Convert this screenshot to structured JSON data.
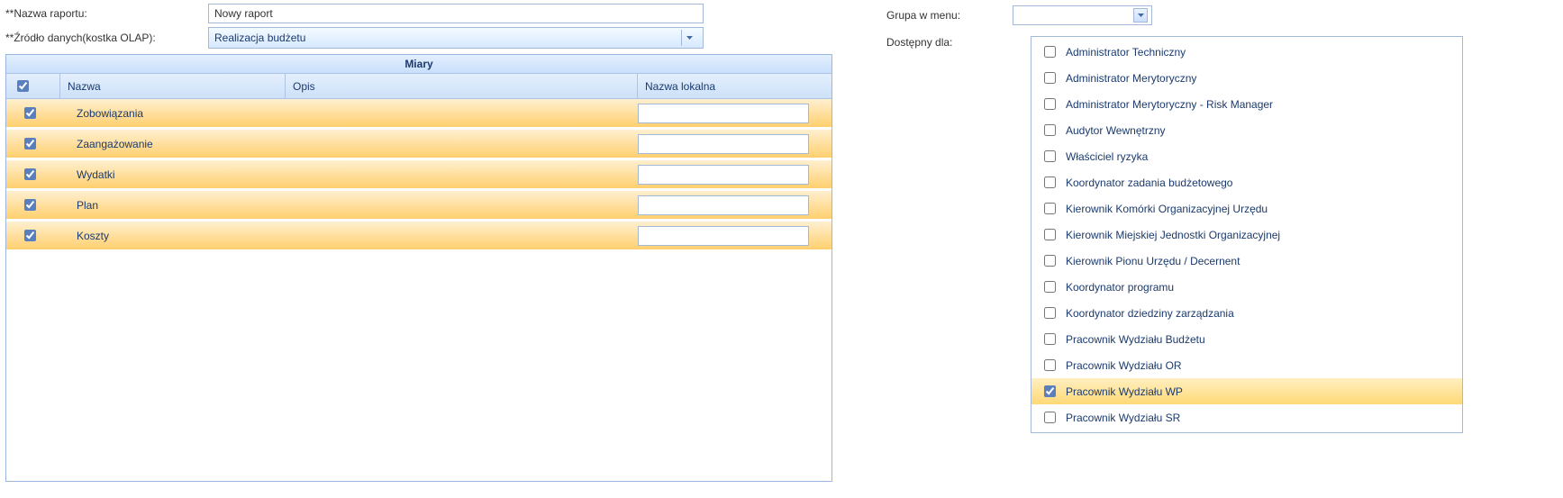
{
  "labels": {
    "report_name": "**Nazwa raportu:",
    "data_source": "**Źródło danych(kostka OLAP):",
    "group_menu": "Grupa w menu:",
    "available_for": "Dostępny dla:"
  },
  "form": {
    "report_name_value": "Nowy raport",
    "data_source_value": "Realizacja budżetu",
    "group_menu_value": ""
  },
  "measures": {
    "title": "Miary",
    "header_name": "Nazwa",
    "header_desc": "Opis",
    "header_local": "Nazwa lokalna",
    "rows": [
      {
        "checked": true,
        "name": "Zobowiązania",
        "desc": "",
        "local": ""
      },
      {
        "checked": true,
        "name": "Zaangażowanie",
        "desc": "",
        "local": ""
      },
      {
        "checked": true,
        "name": "Wydatki",
        "desc": "",
        "local": ""
      },
      {
        "checked": true,
        "name": "Plan",
        "desc": "",
        "local": ""
      },
      {
        "checked": true,
        "name": "Koszty",
        "desc": "",
        "local": ""
      }
    ]
  },
  "roles": [
    {
      "checked": false,
      "selected": false,
      "label": "Administrator Techniczny"
    },
    {
      "checked": false,
      "selected": false,
      "label": "Administrator Merytoryczny"
    },
    {
      "checked": false,
      "selected": false,
      "label": "Administrator Merytoryczny - Risk Manager"
    },
    {
      "checked": false,
      "selected": false,
      "label": "Audytor Wewnętrzny"
    },
    {
      "checked": false,
      "selected": false,
      "label": "Właściciel ryzyka"
    },
    {
      "checked": false,
      "selected": false,
      "label": "Koordynator zadania budżetowego"
    },
    {
      "checked": false,
      "selected": false,
      "label": "Kierownik Komórki Organizacyjnej Urzędu"
    },
    {
      "checked": false,
      "selected": false,
      "label": "Kierownik Miejskiej Jednostki Organizacyjnej"
    },
    {
      "checked": false,
      "selected": false,
      "label": "Kierownik Pionu Urzędu / Decernent"
    },
    {
      "checked": false,
      "selected": false,
      "label": "Koordynator programu"
    },
    {
      "checked": false,
      "selected": false,
      "label": "Koordynator dziedziny zarządzania"
    },
    {
      "checked": false,
      "selected": false,
      "label": "Pracownik Wydziału Budżetu"
    },
    {
      "checked": false,
      "selected": false,
      "label": "Pracownik Wydziału OR"
    },
    {
      "checked": true,
      "selected": true,
      "label": "Pracownik Wydziału WP"
    },
    {
      "checked": false,
      "selected": false,
      "label": "Pracownik Wydziału SR"
    }
  ]
}
